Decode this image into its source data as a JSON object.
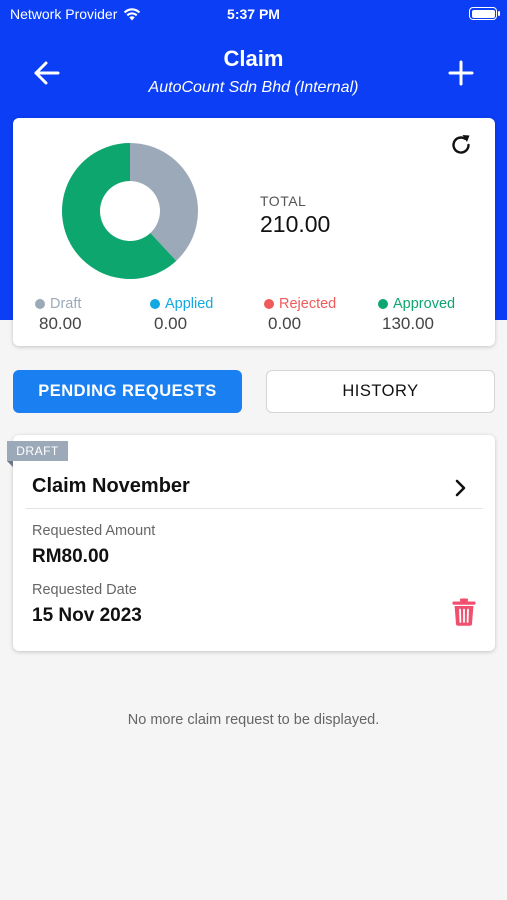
{
  "status_bar": {
    "carrier": "Network Provider",
    "time": "5:37 PM"
  },
  "header": {
    "title": "Claim",
    "subtitle": "AutoCount Sdn Bhd (Internal)"
  },
  "icons": {
    "back": "arrow-left-icon",
    "add": "plus-icon",
    "refresh": "refresh-icon",
    "chevron": "chevron-right-icon",
    "delete": "trash-icon",
    "wifi": "wifi-icon",
    "battery": "battery-icon"
  },
  "summary": {
    "total_label": "TOTAL",
    "total_value": "210.00",
    "legend": [
      {
        "label": "Draft",
        "value": "80.00",
        "color": "#9ba9b9"
      },
      {
        "label": "Applied",
        "value": "0.00",
        "color": "#13a8e2"
      },
      {
        "label": "Rejected",
        "value": "0.00",
        "color": "#ef5a5a"
      },
      {
        "label": "Approved",
        "value": "130.00",
        "color": "#0ea66f"
      }
    ]
  },
  "chart_data": {
    "type": "pie",
    "categories": [
      "Draft",
      "Applied",
      "Rejected",
      "Approved"
    ],
    "values": [
      80,
      0,
      0,
      130
    ],
    "colors": [
      "#9ba9b9",
      "#13a8e2",
      "#ef5a5a",
      "#0ea66f"
    ]
  },
  "tabs": {
    "pending": "PENDING REQUESTS",
    "history": "HISTORY"
  },
  "claim": {
    "status_tag": "DRAFT",
    "title": "Claim November",
    "amount_label": "Requested Amount",
    "amount_value": "RM80.00",
    "date_label": "Requested Date",
    "date_value": "15 Nov 2023",
    "delete_color": "#f0506e"
  },
  "empty_message": "No more claim request to be displayed.",
  "colors": {
    "header": "#0b3ef5",
    "primary_button": "#1a7ff0",
    "background": "#f5f5f5"
  }
}
